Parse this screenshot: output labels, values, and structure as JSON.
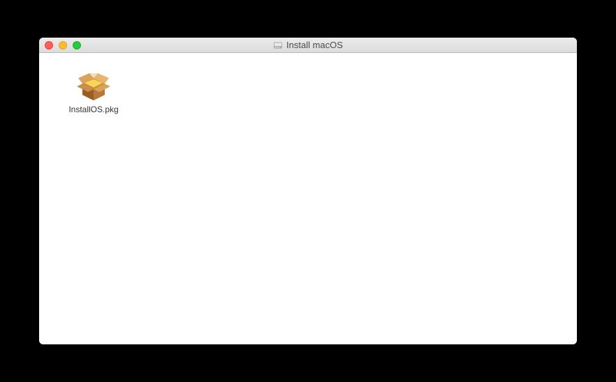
{
  "window": {
    "title": "Install macOS"
  },
  "files": [
    {
      "name": "InstallOS.pkg",
      "icon": "package-icon"
    }
  ]
}
